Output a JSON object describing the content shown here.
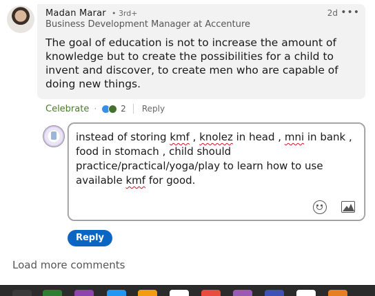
{
  "comment": {
    "author": "Madan Marar",
    "degree": "• 3rd+",
    "headline": "Business Development Manager at Accenture",
    "time": "2d",
    "more_icon": "ellipsis-icon",
    "text": "The goal of education is not to increase the amount of knowledge but to create the possibilities for a child to invent and discover, to create men who are capable of doing new things."
  },
  "actions": {
    "celebrate_label": "Celebrate",
    "reaction_count": "2",
    "reply_label": "Reply",
    "reaction_icons": [
      "like-icon",
      "celebrate-icon"
    ]
  },
  "reply_box": {
    "text_parts": [
      {
        "t": "instead of storing ",
        "sp": false
      },
      {
        "t": "kmf",
        "sp": true
      },
      {
        "t": " , ",
        "sp": false
      },
      {
        "t": "knolez",
        "sp": true
      },
      {
        "t": " in head , ",
        "sp": false
      },
      {
        "t": "mni",
        "sp": true
      },
      {
        "t": " in bank , food in stomach , child should practice/practical/yoga/play  to learn how to use available ",
        "sp": false
      },
      {
        "t": "kmf",
        "sp": true
      },
      {
        "t": " for good.",
        "sp": false
      }
    ],
    "emoji_icon": "emoji-icon",
    "image_icon": "image-icon"
  },
  "reply_button": "Reply",
  "load_more": "Load more comments",
  "colors": {
    "brand_blue": "#0a66c2",
    "celebrate_green": "#4a7b2a",
    "bubble_bg": "#f2f2f2",
    "taskbar_bg": "#2b2b2b"
  },
  "taskbar": {
    "apps": [
      {
        "icon": "app-icon-1",
        "color": "#3a3a3a"
      },
      {
        "icon": "app-icon-2",
        "color": "#2e7d32"
      },
      {
        "icon": "app-icon-3",
        "color": "#8e44ad"
      },
      {
        "icon": "app-icon-4",
        "color": "#2196f3"
      },
      {
        "icon": "app-icon-5",
        "color": "#f39c12"
      },
      {
        "icon": "app-icon-6",
        "color": "#ffffff"
      },
      {
        "icon": "app-icon-7",
        "color": "#e74c3c"
      },
      {
        "icon": "app-icon-8",
        "color": "#9b59b6"
      },
      {
        "icon": "app-icon-9",
        "color": "#3f51b5"
      },
      {
        "icon": "app-icon-10",
        "color": "#ffffff"
      },
      {
        "icon": "app-icon-11",
        "color": "#e67e22"
      }
    ]
  }
}
